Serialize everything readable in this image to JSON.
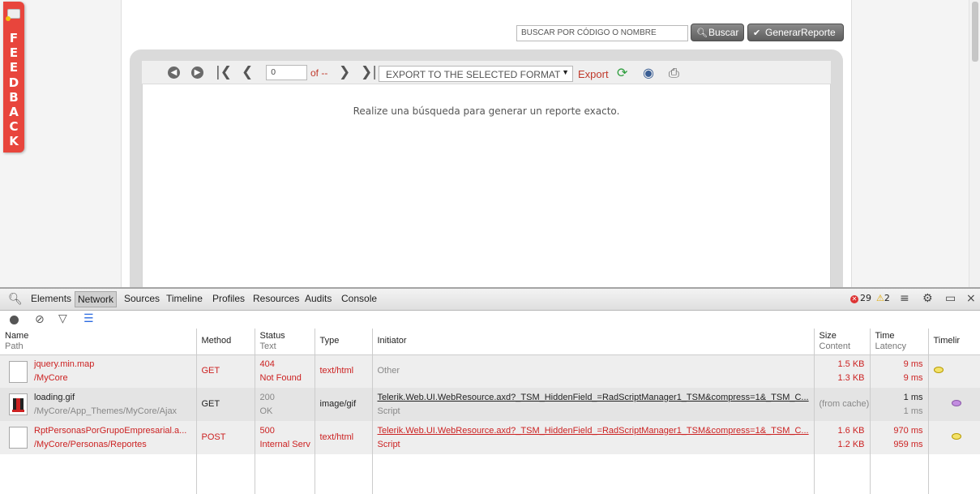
{
  "feedback": {
    "label": "FEEDBACK"
  },
  "search": {
    "placeholder": "BUSCAR POR CÓDIGO O NOMBRE",
    "button": "Buscar",
    "report_button": "GenerarReporte"
  },
  "report_toolbar": {
    "page_value": "0",
    "of_text": "of --",
    "format_select": "EXPORT TO THE SELECTED FORMAT",
    "export_link": "Export"
  },
  "report": {
    "message": "Realize una búsqueda para generar un reporte exacto."
  },
  "devtools": {
    "tabs": [
      "Elements",
      "Network",
      "Sources",
      "Timeline",
      "Profiles",
      "Resources",
      "Audits",
      "Console"
    ],
    "active_tab": "Network",
    "error_count": "29",
    "warning_count": "2",
    "columns": {
      "name": "Name",
      "path": "Path",
      "method": "Method",
      "status": "Status",
      "status_text": "Text",
      "type": "Type",
      "initiator": "Initiator",
      "size": "Size",
      "content": "Content",
      "time": "Time",
      "latency": "Latency",
      "timeline": "Timelir"
    },
    "rows": [
      {
        "name": "jquery.min.map",
        "path": "/MyCore",
        "method": "GET",
        "status": "404",
        "status_text": "Not Found",
        "type": "text/html",
        "initiator": "Other",
        "initiator_sub": "",
        "size": "1.5 KB",
        "content": "1.3 KB",
        "time": "9 ms",
        "latency": "9 ms"
      },
      {
        "name": "loading.gif",
        "path": "/MyCore/App_Themes/MyCore/Ajax",
        "method": "GET",
        "status": "200",
        "status_text": "OK",
        "type": "image/gif",
        "initiator": "Telerik.Web.UI.WebResource.axd?_TSM_HiddenField_=RadScriptManager1_TSM&compress=1&_TSM_C...",
        "initiator_sub": "Script",
        "size": "(from cache)",
        "content": "",
        "time": "1 ms",
        "latency": "1 ms"
      },
      {
        "name": "RptPersonasPorGrupoEmpresarial.a...",
        "path": "/MyCore/Personas/Reportes",
        "method": "POST",
        "status": "500",
        "status_text": "Internal Serv",
        "type": "text/html",
        "initiator": "Telerik.Web.UI.WebResource.axd?_TSM_HiddenField_=RadScriptManager1_TSM&compress=1&_TSM_C...",
        "initiator_sub": "Script",
        "size": "1.6 KB",
        "content": "1.2 KB",
        "time": "970 ms",
        "latency": "959 ms"
      }
    ]
  }
}
